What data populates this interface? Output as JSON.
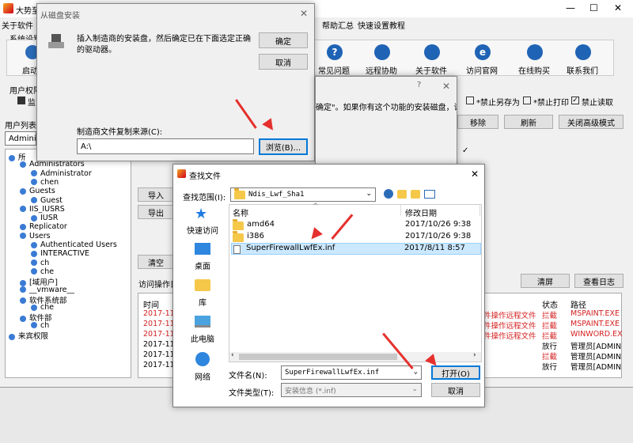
{
  "main": {
    "title": "大势至",
    "menu": [
      "关于软件",
      "帮助汇总",
      "快速设置教程"
    ],
    "section_label": "系统设置",
    "start_label": "启动",
    "toolbar": [
      {
        "label": "常见问题",
        "icon": "question-icon"
      },
      {
        "label": "远程协助",
        "icon": "remote-icon"
      },
      {
        "label": "关于软件",
        "icon": "info-icon"
      },
      {
        "label": "访问官网",
        "icon": "ie-icon"
      },
      {
        "label": "在线购买",
        "icon": "cart-icon"
      },
      {
        "label": "联系我们",
        "icon": "phone-icon"
      }
    ],
    "user_perm_label": "用户权限",
    "monitor_label": "监",
    "checkboxes": [
      {
        "label": "*禁止另存为",
        "checked": false
      },
      {
        "label": "*禁止打印",
        "checked": false
      },
      {
        "label": "禁止读取",
        "checked": true
      }
    ],
    "user_list_label": "用户列表",
    "user_select": "Administ",
    "actions": [
      "移除",
      "刷新",
      "关闭高级模式"
    ],
    "side_buttons": [
      "导入",
      "导出",
      "清空"
    ],
    "log_label": "访问操作日",
    "log_buttons": [
      "清屏",
      "查看日志"
    ],
    "log_headers": {
      "time": "时间",
      "status": "状态",
      "path": "路径"
    },
    "log_rows": [
      {
        "time": "2017-11-",
        "op": "件操作远程文件",
        "status": "拦截",
        "path": "MSPAINT.EXE",
        "red": true
      },
      {
        "time": "2017-11-",
        "op": "件操作远程文件",
        "status": "拦截",
        "path": "MSPAINT.EXE",
        "red": true
      },
      {
        "time": "2017-11-",
        "op": "件操作远程文件",
        "status": "拦截",
        "path": "WINWORD.EX",
        "red": true
      },
      {
        "time": "2017-11-",
        "op": "",
        "status": "放行",
        "path": "管理员[ADMIN",
        "red": false
      },
      {
        "time": "2017-11-",
        "op": "",
        "status": "拦截",
        "path": "管理员[ADMIN",
        "red": false
      },
      {
        "time": "2017-11-",
        "op": "",
        "status": "放行",
        "path": "管理员[ADMIN",
        "red": false
      }
    ],
    "tree": [
      {
        "label": "所",
        "level": 0
      },
      {
        "label": "Administrators",
        "level": 1
      },
      {
        "label": "Administrator",
        "level": 2
      },
      {
        "label": "chen",
        "level": 2
      },
      {
        "label": "Guests",
        "level": 1
      },
      {
        "label": "Guest",
        "level": 2
      },
      {
        "label": "IIS_IUSRS",
        "level": 1
      },
      {
        "label": "IUSR",
        "level": 2
      },
      {
        "label": "Replicator",
        "level": 1
      },
      {
        "label": "Users",
        "level": 1
      },
      {
        "label": "Authenticated Users",
        "level": 2
      },
      {
        "label": "INTERACTIVE",
        "level": 2
      },
      {
        "label": "ch",
        "level": 2
      },
      {
        "label": "che",
        "level": 2
      },
      {
        "label": "[域用户]",
        "level": 1
      },
      {
        "label": "__vmware__",
        "level": 1
      },
      {
        "label": "软件系统部",
        "level": 1
      },
      {
        "label": "che",
        "level": 2
      },
      {
        "label": "软件部",
        "level": 1
      },
      {
        "label": "ch",
        "level": 2
      },
      {
        "label": "来宾权限",
        "level": 0
      }
    ]
  },
  "install_dialog": {
    "title": "从磁盘安装",
    "message": "插入制造商的安装盘，然后确定已在下面选定正确的驱动器。",
    "ok": "确定",
    "cancel": "取消",
    "source_label": "制造商文件复制来源(C):",
    "source_value": "A:\\",
    "browse": "浏览(B)..."
  },
  "mid_dialog": {
    "text": "确定\"。如果你有这个功能的安装磁盘，请单",
    "help": "?",
    "close": "✕"
  },
  "find_dialog": {
    "title": "查找文件",
    "lookin_label": "查找范围(I):",
    "lookin_value": "Ndis_Lwf_Sha1",
    "places": [
      {
        "label": "快速访问",
        "icon": "star-icon"
      },
      {
        "label": "桌面",
        "icon": "desktop-icon"
      },
      {
        "label": "库",
        "icon": "library-icon"
      },
      {
        "label": "此电脑",
        "icon": "computer-icon"
      },
      {
        "label": "网络",
        "icon": "network-icon"
      }
    ],
    "col_name": "名称",
    "col_date": "修改日期",
    "files": [
      {
        "name": "amd64",
        "date": "2017/10/26 9:38",
        "type": "folder",
        "selected": false
      },
      {
        "name": "i386",
        "date": "2017/10/26 9:38",
        "type": "folder",
        "selected": false
      },
      {
        "name": "SuperFirewallLwfEx.inf",
        "date": "2017/8/11 8:57",
        "type": "inf",
        "selected": true
      }
    ],
    "filename_label": "文件名(N):",
    "filename_value": "SuperFirewallLwfEx.inf",
    "filetype_label": "文件类型(T):",
    "filetype_value": "安装信息 (*.inf)",
    "open": "打开(O)",
    "cancel": "取消"
  }
}
